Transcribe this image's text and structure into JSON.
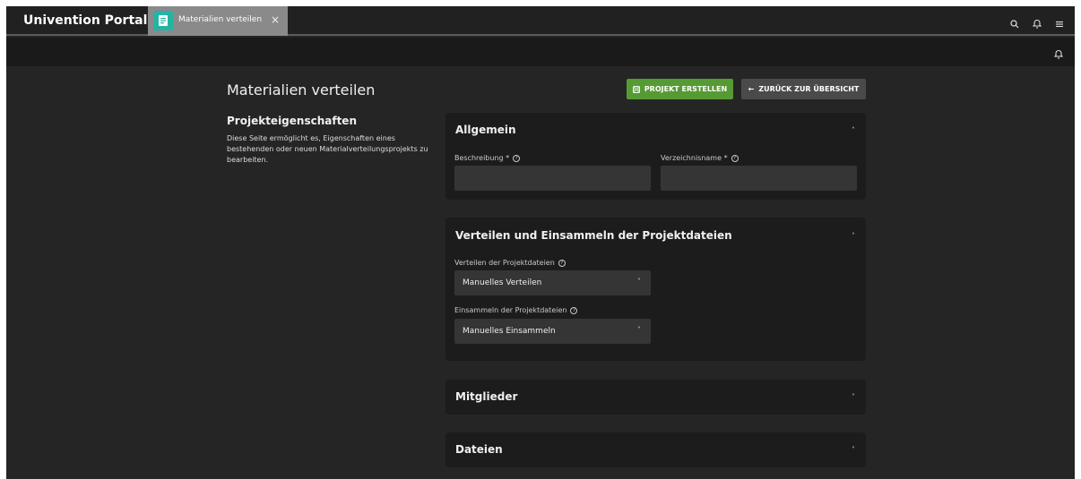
{
  "topbar": {
    "portal_title": "Univention Portal",
    "tab": {
      "label": "Materialien verteilen",
      "close": "×"
    },
    "icons": [
      "search-icon",
      "bell-icon",
      "menu-icon"
    ]
  },
  "page": {
    "title": "Materialien verteilen",
    "create_button": "PROJEKT ERSTELLEN",
    "back_button": "ZURÜCK ZUR ÜBERSICHT",
    "back_arrow": "←"
  },
  "sidebar": {
    "title": "Projekteigenschaften",
    "description": "Diese Seite ermöglicht es, Eigenschaften eines bestehenden oder neuen Materialverteilungsprojekts zu bearbeiten."
  },
  "sections": {
    "allgemein": {
      "title": "Allgemein",
      "chevron": "˄",
      "description_label": "Beschreibung *",
      "description_value": "",
      "dirname_label": "Verzeichnisname *",
      "dirname_value": ""
    },
    "distribution": {
      "title": "Verteilen und Einsammeln der Projektdateien",
      "chevron": "˄",
      "distribute_label": "Verteilen der Projektdateien",
      "distribute_value": "Manuelles Verteilen",
      "collect_label": "Einsammeln der Projektdateien",
      "collect_value": "Manuelles Einsammeln"
    },
    "members": {
      "title": "Mitglieder",
      "chevron": "˅"
    },
    "files": {
      "title": "Dateien",
      "chevron": "˅"
    }
  },
  "colors": {
    "accent_green": "#569a34",
    "tab_icon_teal": "#25b3a4",
    "background": "#252525",
    "card": "#1c1c1c"
  }
}
